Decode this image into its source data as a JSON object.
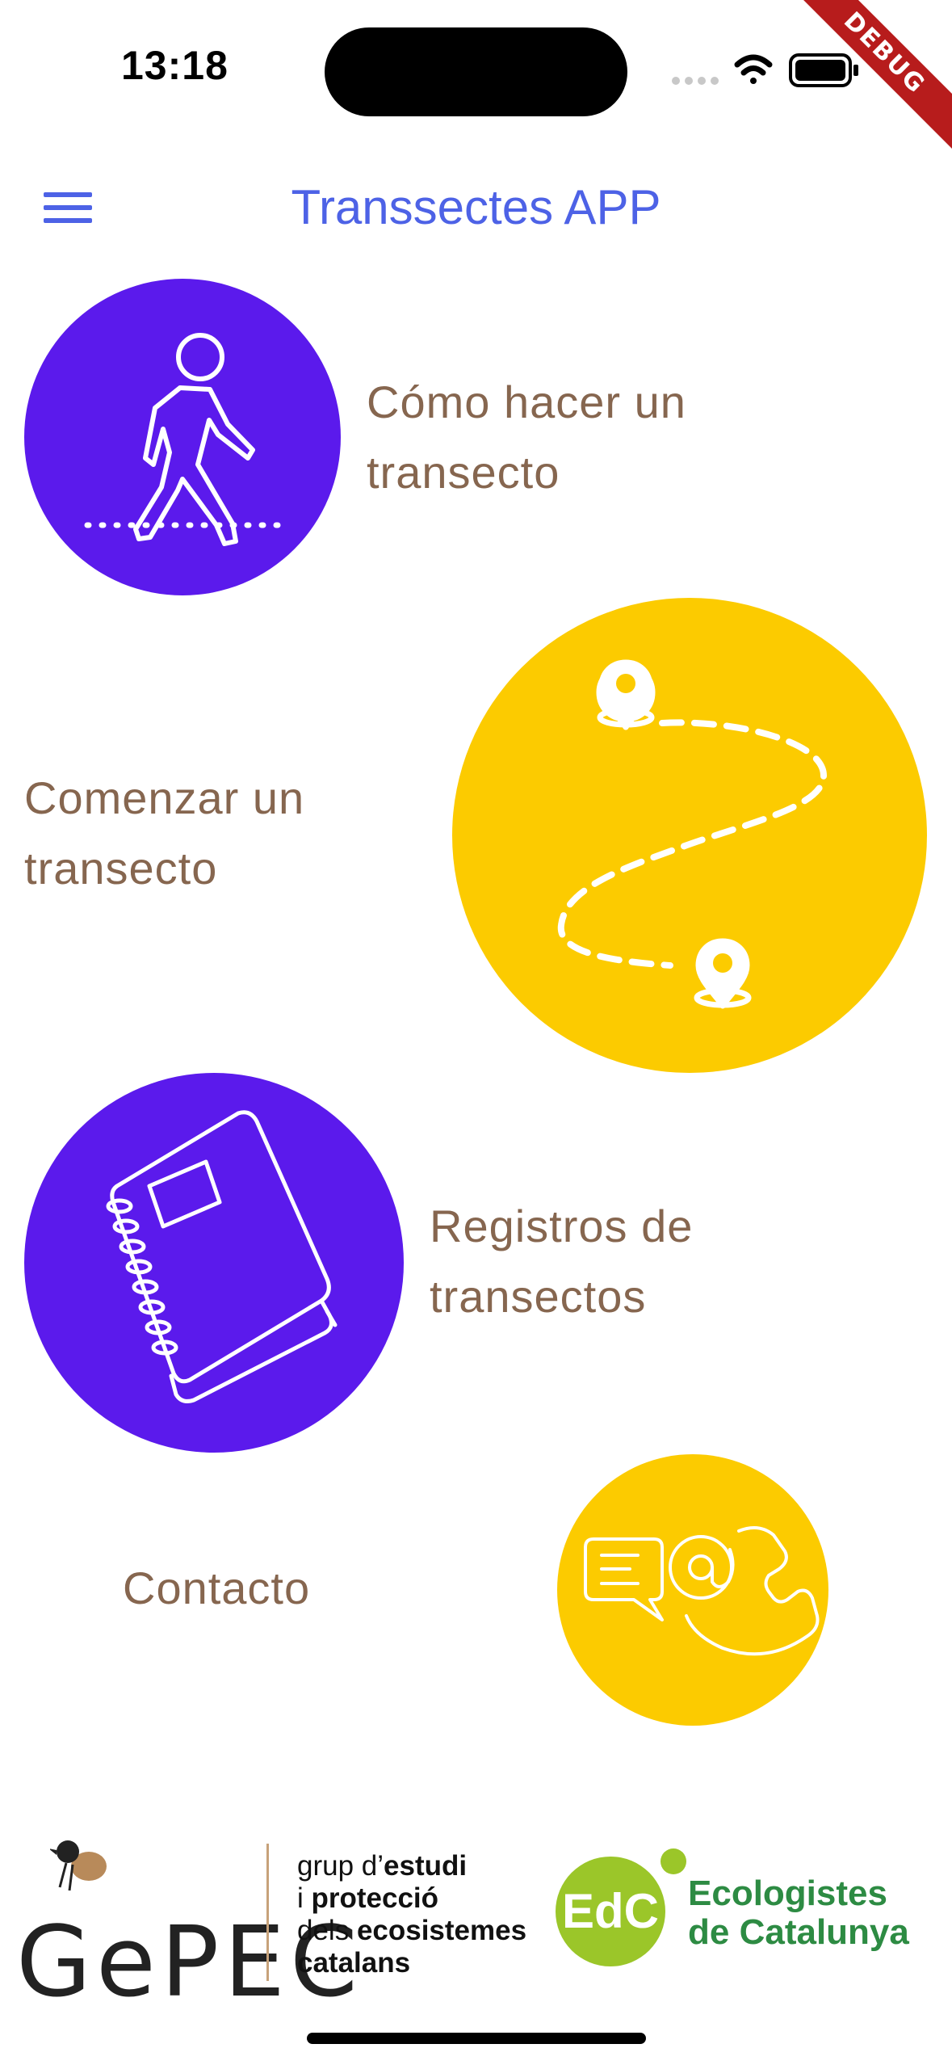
{
  "status_bar": {
    "time": "13:18",
    "icons": [
      "cellular-signal-icon",
      "wifi-icon",
      "battery-icon"
    ],
    "debug_banner": "DEBUG"
  },
  "app_bar": {
    "title": "Transsectes APP",
    "menu_icon": "hamburger-menu-icon",
    "accent_color": "#4d62e6"
  },
  "menu": {
    "items": [
      {
        "label": "Cómo hacer un transecto",
        "icon": "walking-person-icon",
        "color": "#5b1aec"
      },
      {
        "label": "Comenzar un transecto",
        "icon": "route-map-pins-icon",
        "color": "#fccb00"
      },
      {
        "label": "Registros de transectos",
        "icon": "spiral-notebook-icon",
        "color": "#5b1aec"
      },
      {
        "label": "Contacto",
        "icon": "contact-email-phone-icon",
        "color": "#fccb00"
      }
    ],
    "label_color": "#86664f"
  },
  "footer": {
    "gepec": {
      "logo_text": "GePEC",
      "desc_lines": [
        {
          "normal": "grup d’",
          "bold": "estudi"
        },
        {
          "normal": "i ",
          "bold": "protecció"
        },
        {
          "normal": "dels ",
          "bold": "ecosistemes"
        },
        {
          "normal": "",
          "bold": "catalans"
        }
      ]
    },
    "edc": {
      "badge": "EdC",
      "name_line1": "Ecologistes",
      "name_line2": "de Catalunya",
      "color": "#2d8b43"
    }
  }
}
